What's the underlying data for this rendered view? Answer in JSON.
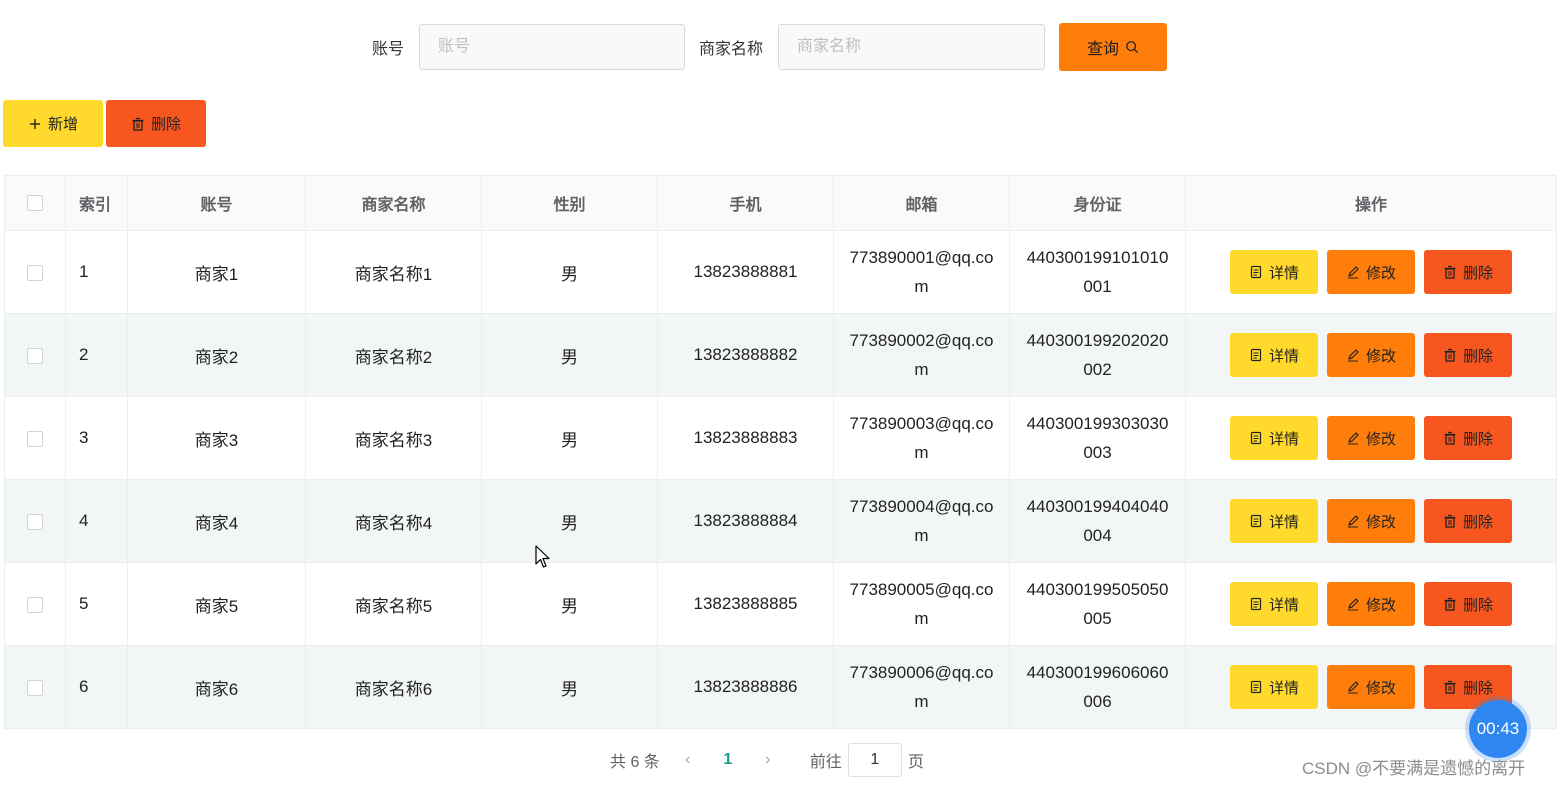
{
  "search": {
    "account_label": "账号",
    "account_placeholder": "账号",
    "account_value": "",
    "merchant_label": "商家名称",
    "merchant_placeholder": "商家名称",
    "merchant_value": "",
    "query_label": "查询",
    "query_icon": "search-icon"
  },
  "toolbar": {
    "add_label": "新增",
    "add_icon": "plus-icon",
    "delete_label": "删除",
    "delete_icon": "trash-icon"
  },
  "table": {
    "headers": [
      "",
      "索引",
      "账号",
      "商家名称",
      "性别",
      "手机",
      "邮箱",
      "身份证",
      "操作"
    ],
    "rows": [
      {
        "index": "1",
        "account": "商家1",
        "name": "商家名称1",
        "gender": "男",
        "phone": "13823888881",
        "email": "773890001@qq.com",
        "id_card": "440300199101010001"
      },
      {
        "index": "2",
        "account": "商家2",
        "name": "商家名称2",
        "gender": "男",
        "phone": "13823888882",
        "email": "773890002@qq.com",
        "id_card": "440300199202020002"
      },
      {
        "index": "3",
        "account": "商家3",
        "name": "商家名称3",
        "gender": "男",
        "phone": "13823888883",
        "email": "773890003@qq.com",
        "id_card": "440300199303030003"
      },
      {
        "index": "4",
        "account": "商家4",
        "name": "商家名称4",
        "gender": "男",
        "phone": "13823888884",
        "email": "773890004@qq.com",
        "id_card": "440300199404040004"
      },
      {
        "index": "5",
        "account": "商家5",
        "name": "商家名称5",
        "gender": "男",
        "phone": "13823888885",
        "email": "773890005@qq.com",
        "id_card": "440300199505050005"
      },
      {
        "index": "6",
        "account": "商家6",
        "name": "商家名称6",
        "gender": "男",
        "phone": "13823888886",
        "email": "773890006@qq.com",
        "id_card": "440300199606060006"
      }
    ],
    "actions": {
      "detail_label": "详情",
      "detail_icon": "document-icon",
      "edit_label": "修改",
      "edit_icon": "pencil-icon",
      "delete_label": "删除",
      "delete_icon": "trash-icon"
    }
  },
  "pagination": {
    "total_text": "共 6 条",
    "prev_icon": "chevron-left-icon",
    "current_page": "1",
    "next_icon": "chevron-right-icon",
    "goto_label": "前往",
    "goto_value": "1",
    "page_suffix": "页"
  },
  "overlay": {
    "timer": "00:43",
    "watermark": "CSDN @不要满是遗憾的离开"
  },
  "colors": {
    "yellow": "#ffd92b",
    "orange": "#ff7d0a",
    "red_orange": "#f7571f",
    "active_page": "#12a08a",
    "timer_blue": "#2e86f0"
  }
}
